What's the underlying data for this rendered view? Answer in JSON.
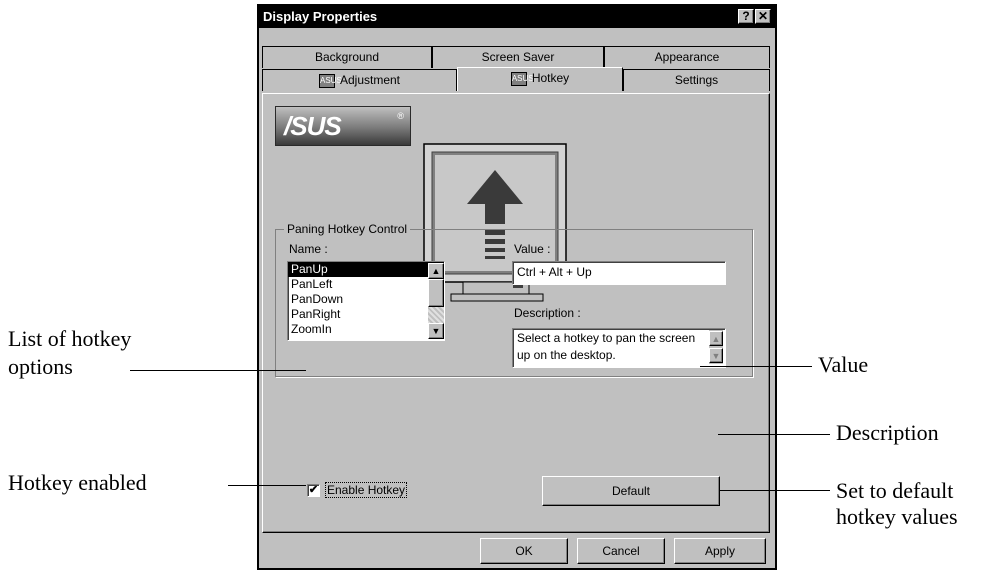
{
  "window": {
    "title": "Display Properties",
    "help_label": "?",
    "close_label": "✕"
  },
  "tabs": {
    "row1": [
      {
        "label": "Background"
      },
      {
        "label": "Screen Saver"
      },
      {
        "label": "Appearance"
      }
    ],
    "row2": [
      {
        "label": "Adjustment",
        "icon": "asus-tab-icon"
      },
      {
        "label": "Hotkey",
        "icon": "asus-tab-icon",
        "active": true
      },
      {
        "label": "Settings"
      }
    ],
    "icon_text": "ASUS"
  },
  "logo": {
    "text": "/SUS",
    "mark": "®"
  },
  "illustration": {
    "icon": "pan-up-arrow-monitor-icon"
  },
  "group": {
    "legend": "Paning Hotkey Control",
    "name_label": "Name :",
    "value_label": "Value :",
    "description_label": "Description :",
    "list_items": [
      "PanUp",
      "PanLeft",
      "PanDown",
      "PanRight",
      "ZoomIn"
    ],
    "selected_item": "PanUp",
    "value": "Ctrl + Alt + Up",
    "description": "Select a hotkey to pan the screen up on the desktop."
  },
  "enable_hotkey": {
    "label": "Enable Hotkey",
    "checked": true,
    "check_glyph": "✔"
  },
  "buttons": {
    "default": "Default",
    "ok": "OK",
    "cancel": "Cancel",
    "apply": "Apply"
  },
  "callouts": {
    "list_line1": "List of hotkey",
    "list_line2": "options",
    "enabled": "Hotkey enabled",
    "value": "Value",
    "description": "Description",
    "default_line1": "Set to default",
    "default_line2": "hotkey values"
  }
}
